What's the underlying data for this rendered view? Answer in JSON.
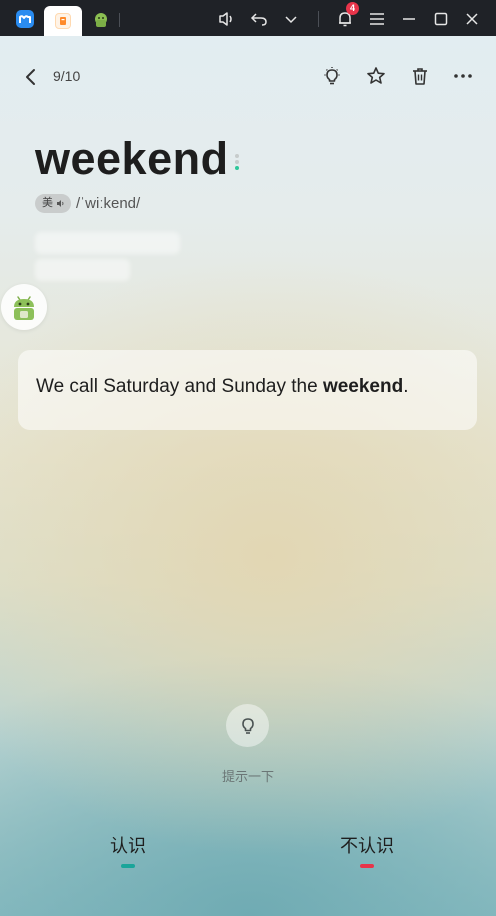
{
  "titlebar": {
    "notification_count": "4"
  },
  "header": {
    "counter": "9/10"
  },
  "word": {
    "text": "weekend",
    "accent_badge": "美",
    "phonetic": "/ˈwiːkend/"
  },
  "example": {
    "before": "We call Saturday and Sunday the ",
    "highlight": "weekend",
    "after": "."
  },
  "hint": {
    "label": "提示一下"
  },
  "choices": {
    "know": "认识",
    "dont_know": "不认识"
  },
  "colors": {
    "know_accent": "#1aa59a",
    "dont_know_accent": "#e8344a",
    "dot_gray": "#c7cccc",
    "dot_green": "#2fc79b"
  },
  "icons": {
    "back": "chevron-left-icon",
    "bulb": "lightbulb-icon",
    "star": "star-icon",
    "trash": "trash-icon",
    "more": "more-icon",
    "speaker": "speaker-icon"
  }
}
